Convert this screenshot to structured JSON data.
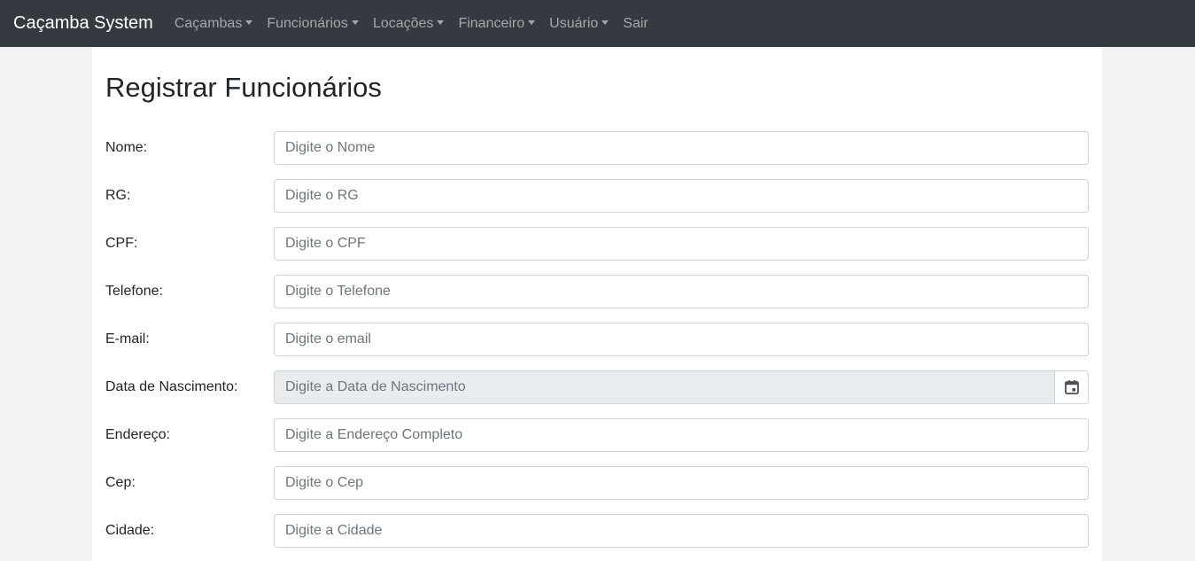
{
  "navbar": {
    "brand": "Caçamba System",
    "items": [
      {
        "label": "Caçambas",
        "dropdown": true
      },
      {
        "label": "Funcionários",
        "dropdown": true
      },
      {
        "label": "Locações",
        "dropdown": true
      },
      {
        "label": "Financeiro",
        "dropdown": true
      },
      {
        "label": "Usuário",
        "dropdown": true
      },
      {
        "label": "Sair",
        "dropdown": false
      }
    ]
  },
  "page": {
    "title": "Registrar Funcionários"
  },
  "form": {
    "fields": [
      {
        "label": "Nome:",
        "placeholder": "Digite o Nome",
        "value": ""
      },
      {
        "label": "RG:",
        "placeholder": "Digite o RG",
        "value": ""
      },
      {
        "label": "CPF:",
        "placeholder": "Digite o CPF",
        "value": ""
      },
      {
        "label": "Telefone:",
        "placeholder": "Digite o Telefone",
        "value": ""
      },
      {
        "label": "E-mail:",
        "placeholder": "Digite o email",
        "value": ""
      },
      {
        "label": "Data de Nascimento:",
        "placeholder": "Digite a Data de Nascimento",
        "value": "",
        "icon": "calendar-icon"
      },
      {
        "label": "Endereço:",
        "placeholder": "Digite a Endereço Completo",
        "value": ""
      },
      {
        "label": "Cep:",
        "placeholder": "Digite o Cep",
        "value": ""
      },
      {
        "label": "Cidade:",
        "placeholder": "Digite a Cidade",
        "value": ""
      }
    ]
  },
  "colors": {
    "navbar_bg": "#343a40",
    "page_bg": "#f2f2f2",
    "readonly_bg": "#e9ecef"
  }
}
